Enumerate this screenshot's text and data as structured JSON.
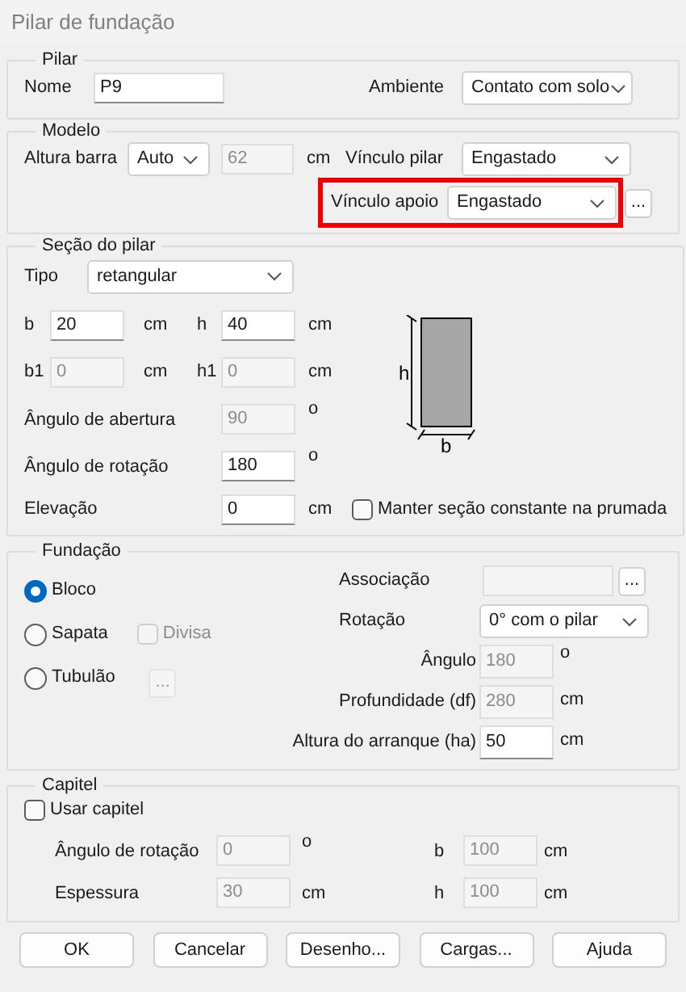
{
  "window": {
    "title": "Pilar de fundação"
  },
  "pilar": {
    "title": "Pilar",
    "nome": {
      "label": "Nome",
      "value": "P9",
      "disabled": false
    },
    "ambiente": {
      "label": "Ambiente",
      "value": "Contato com solo"
    }
  },
  "modelo": {
    "title": "Modelo",
    "altura_barra": {
      "label": "Altura barra",
      "mode": "Auto",
      "value": "62",
      "unit": "cm",
      "disabled": true
    },
    "vinculo_pilar": {
      "label": "Vínculo pilar",
      "value": "Engastado"
    },
    "vinculo_apoio": {
      "label": "Vínculo apoio",
      "value": "Engastado",
      "highlighted": true,
      "button": "..."
    }
  },
  "secao": {
    "title": "Seção do pilar",
    "tipo": {
      "label": "Tipo",
      "value": "retangular"
    },
    "b": {
      "label": "b",
      "value": "20",
      "unit": "cm",
      "disabled": false
    },
    "h": {
      "label": "h",
      "value": "40",
      "unit": "cm",
      "disabled": false
    },
    "b1": {
      "label": "b1",
      "value": "0",
      "unit": "cm",
      "disabled": true
    },
    "h1": {
      "label": "h1",
      "value": "0",
      "unit": "cm",
      "disabled": true
    },
    "angulo_abertura": {
      "label": "Ângulo de abertura",
      "value": "90",
      "unit": "o",
      "disabled": true
    },
    "angulo_rotacao": {
      "label": "Ângulo de rotação",
      "value": "180",
      "unit": "o",
      "disabled": false
    },
    "elevacao": {
      "label": "Elevação",
      "value": "0",
      "unit": "cm",
      "disabled": false
    },
    "manter": {
      "label": "Manter seção constante na prumada",
      "checked": false,
      "disabled": false
    },
    "diagram": {
      "h_label": "h",
      "b_label": "b"
    }
  },
  "fundacao": {
    "title": "Fundação",
    "tipos": [
      {
        "label": "Bloco",
        "selected": true
      },
      {
        "label": "Sapata",
        "selected": false
      },
      {
        "label": "Tubulão",
        "selected": false
      }
    ],
    "divisa": {
      "label": "Divisa",
      "checked": false,
      "disabled": true
    },
    "tubulao_button": {
      "label": "...",
      "disabled": true
    },
    "associacao": {
      "label": "Associação",
      "disabled": true,
      "button": "..."
    },
    "rotacao": {
      "label": "Rotação",
      "value": "0° com o pilar"
    },
    "angulo": {
      "label": "Ângulo",
      "value": "180",
      "unit": "o",
      "disabled": true
    },
    "profundidade": {
      "label": "Profundidade (df)",
      "value": "280",
      "unit": "cm",
      "disabled": true
    },
    "altura_arranque": {
      "label": "Altura do arranque (ha)",
      "value": "50",
      "unit": "cm",
      "disabled": false
    }
  },
  "capitel": {
    "title": "Capitel",
    "usar": {
      "label": "Usar capitel",
      "checked": false,
      "disabled": false
    },
    "angulo_rotacao": {
      "label": "Ângulo de rotação",
      "value": "0",
      "unit": "o",
      "disabled": true
    },
    "b": {
      "label": "b",
      "value": "100",
      "unit": "cm",
      "disabled": true
    },
    "espessura": {
      "label": "Espessura",
      "value": "30",
      "unit": "cm",
      "disabled": true
    },
    "h": {
      "label": "h",
      "value": "100",
      "unit": "cm",
      "disabled": true
    }
  },
  "buttons": [
    {
      "label": "OK"
    },
    {
      "label": "Cancelar"
    },
    {
      "label": "Desenho..."
    },
    {
      "label": "Cargas..."
    },
    {
      "label": "Ajuda"
    }
  ]
}
